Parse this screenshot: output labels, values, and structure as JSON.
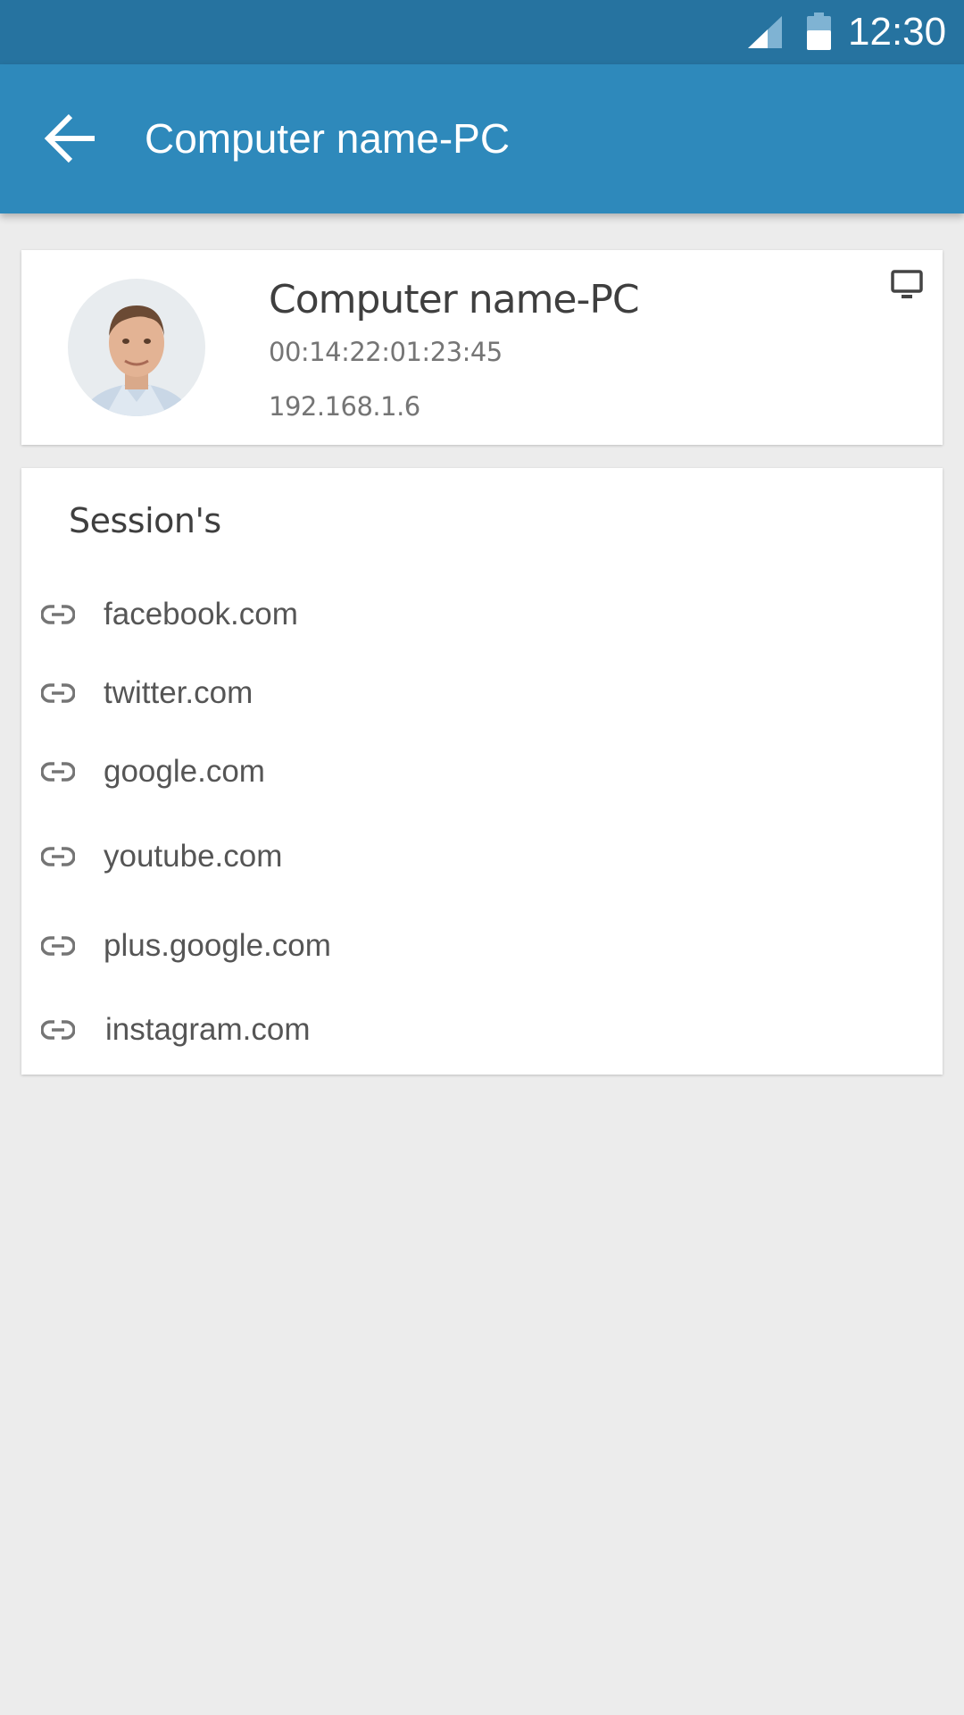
{
  "status_bar": {
    "time": "12:30",
    "signal_icon": "signal-icon",
    "battery_icon": "battery-icon"
  },
  "app_bar": {
    "back_icon": "arrow-back-icon",
    "title": "Computer name-PC",
    "color": "#2e89bb"
  },
  "device": {
    "name": "Computer name-PC",
    "mac": "00:14:22:01:23:45",
    "ip": "192.168.1.6",
    "type_icon": "monitor-icon"
  },
  "sessions": {
    "heading": "Session's",
    "items": [
      {
        "label": "facebook.com",
        "icon": "link-icon"
      },
      {
        "label": "twitter.com",
        "icon": "link-icon"
      },
      {
        "label": "google.com",
        "icon": "link-icon"
      },
      {
        "label": "youtube.com",
        "icon": "link-icon"
      },
      {
        "label": "plus.google.com",
        "icon": "link-icon"
      },
      {
        "label": "instagram.com",
        "icon": "link-icon"
      }
    ]
  },
  "colors": {
    "status_bar": "#2673a0",
    "app_bar": "#2e89bb",
    "background": "#ececec",
    "card": "#ffffff"
  }
}
